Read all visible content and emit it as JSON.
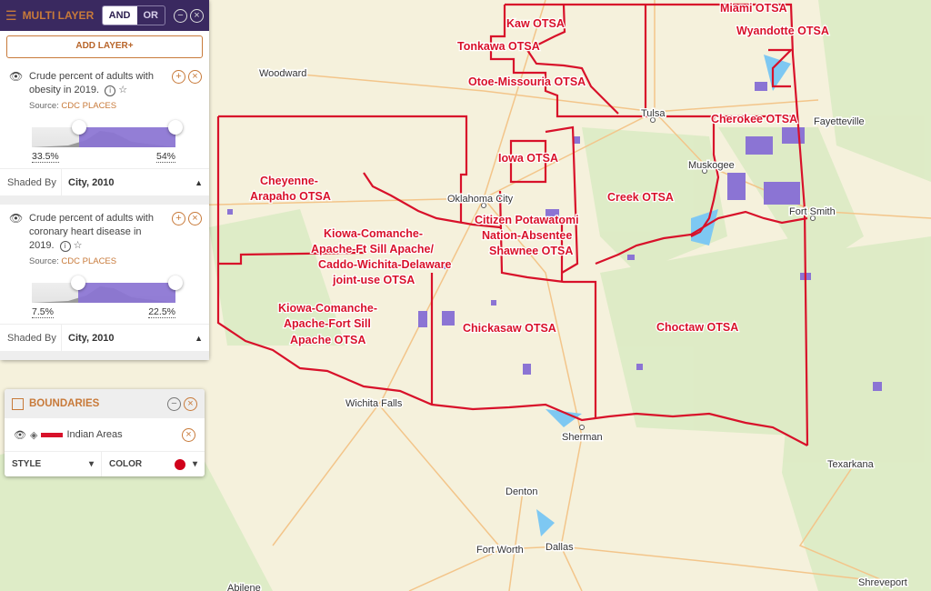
{
  "multi_layer": {
    "title": "MULTI LAYER",
    "icon": "layers-icon",
    "toggle": {
      "and": "AND",
      "or": "OR",
      "selected": "AND"
    },
    "add_layer": "ADD LAYER+"
  },
  "layers": [
    {
      "title": "Crude percent of adults with obesity in 2019.",
      "source_label": "Source:",
      "source": "CDC PLACES",
      "min": "33.5%",
      "max": "54%",
      "range_fraction": [
        0.33,
        1.0
      ],
      "shaded_by_label": "Shaded By",
      "shaded_by": "City, 2010"
    },
    {
      "title": "Crude percent of adults with coronary heart disease in 2019.",
      "source_label": "Source:",
      "source": "CDC PLACES",
      "min": "7.5%",
      "max": "22.5%",
      "range_fraction": [
        0.32,
        1.0
      ],
      "shaded_by_label": "Shaded By",
      "shaded_by": "City, 2010"
    }
  ],
  "boundaries": {
    "title": "BOUNDARIES",
    "layer": "Indian Areas",
    "line_color": "#d8112a",
    "style_label": "STYLE",
    "color_label": "COLOR",
    "color": "#d0021b"
  },
  "colors": {
    "accent": "#c87a3a",
    "header": "#3a2960",
    "fill": "#8b74d4",
    "boundary": "#d8112a"
  },
  "map": {
    "cities": [
      "Woodward",
      "Tulsa",
      "Fayetteville",
      "Muskogee",
      "Oklahoma City",
      "Fort Smith",
      "Wichita Falls",
      "Sherman",
      "Texarkana",
      "Denton",
      "Fort Worth",
      "Dallas",
      "Abilene",
      "Shreveport"
    ],
    "otsa": [
      "Kaw OTSA",
      "Tonkawa OTSA",
      "Miami OTSA",
      "Wyandotte OTSA",
      "Otoe-Missouria OTSA",
      "Cherokee OTSA",
      "Iowa OTSA",
      "Cheyenne-",
      "Arapaho OTSA",
      "Creek OTSA",
      "Citizen Potawatomi",
      "Nation-Absentee",
      "Shawnee OTSA",
      "Kiowa-Comanche-",
      "Apache-Ft Sill Apache/",
      "Caddo-Wichita-Delaware",
      "joint-use OTSA",
      "Kiowa-Comanche-",
      "Apache-Fort Sill",
      "Apache OTSA",
      "Chickasaw OTSA",
      "Choctaw OTSA"
    ]
  }
}
